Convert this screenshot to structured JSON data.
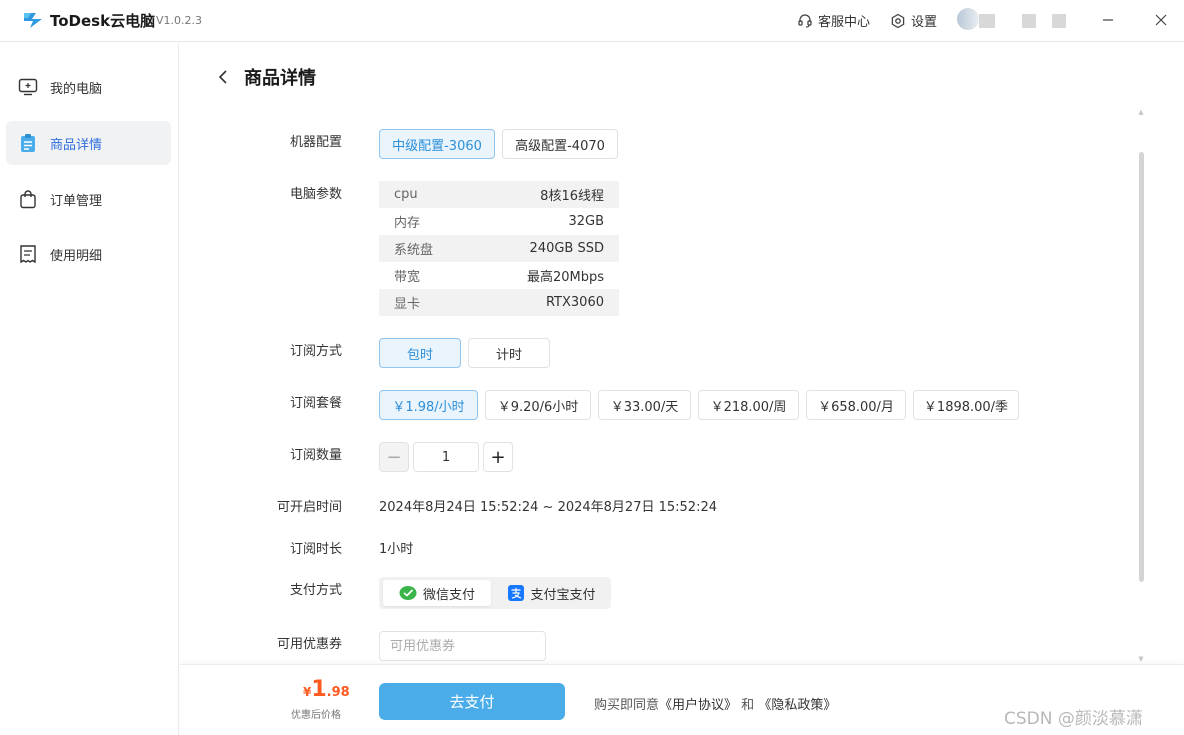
{
  "app": {
    "name": "ToDesk云电脑",
    "version": "V1.0.2.3"
  },
  "titlebar": {
    "support_label": "客服中心",
    "settings_label": "设置"
  },
  "sidebar": {
    "items": [
      {
        "label": "我的电脑",
        "icon": "monitor-icon",
        "active": false
      },
      {
        "label": "商品详情",
        "icon": "clipboard-icon",
        "active": true
      },
      {
        "label": "订单管理",
        "icon": "shopping-bag-icon",
        "active": false
      },
      {
        "label": "使用明细",
        "icon": "receipt-icon",
        "active": false
      }
    ]
  },
  "page": {
    "title": "商品详情"
  },
  "form": {
    "config": {
      "label": "机器配置",
      "options": [
        "中级配置-3060",
        "高级配置-4070"
      ],
      "selected": 0
    },
    "specs": {
      "label": "电脑参数",
      "rows": [
        {
          "key": "cpu",
          "value": "8核16线程"
        },
        {
          "key": "内存",
          "value": "32GB"
        },
        {
          "key": "系统盘",
          "value": "240GB SSD"
        },
        {
          "key": "带宽",
          "value": "最高20Mbps"
        },
        {
          "key": "显卡",
          "value": "RTX3060"
        }
      ]
    },
    "subscription_mode": {
      "label": "订阅方式",
      "options": [
        "包时",
        "计时"
      ],
      "selected": 0
    },
    "plan": {
      "label": "订阅套餐",
      "options": [
        "￥1.98/小时",
        "￥9.20/6小时",
        "￥33.00/天",
        "￥218.00/周",
        "￥658.00/月",
        "￥1898.00/季"
      ],
      "selected": 0
    },
    "quantity": {
      "label": "订阅数量",
      "value": "1",
      "minus": "−",
      "plus": "+"
    },
    "start_time": {
      "label": "可开启时间",
      "value": "2024年8月24日 15:52:24 ~ 2024年8月27日 15:52:24"
    },
    "duration": {
      "label": "订阅时长",
      "value": "1小时"
    },
    "payment": {
      "label": "支付方式",
      "options": [
        "微信支付",
        "支付宝支付"
      ],
      "selected": 0
    },
    "coupon": {
      "label": "可用优惠券",
      "placeholder": "可用优惠券"
    }
  },
  "footer": {
    "currency": "¥",
    "price_int": "1",
    "price_dec": ".98",
    "price_caption": "优惠后价格",
    "pay_button": "去支付",
    "agree_prefix": "购买即同意",
    "user_agreement": "《用户协议》",
    "and": "和",
    "privacy_policy": "《隐私政策》"
  },
  "watermark": "CSDN @颜淡慕潇",
  "colors": {
    "accent": "#4aace8",
    "selected_bg": "#e9f4fd",
    "selected_text": "#2e8fd9",
    "price": "#ff5a1f",
    "wechat": "#3bb54a",
    "alipay": "#1677ff"
  }
}
